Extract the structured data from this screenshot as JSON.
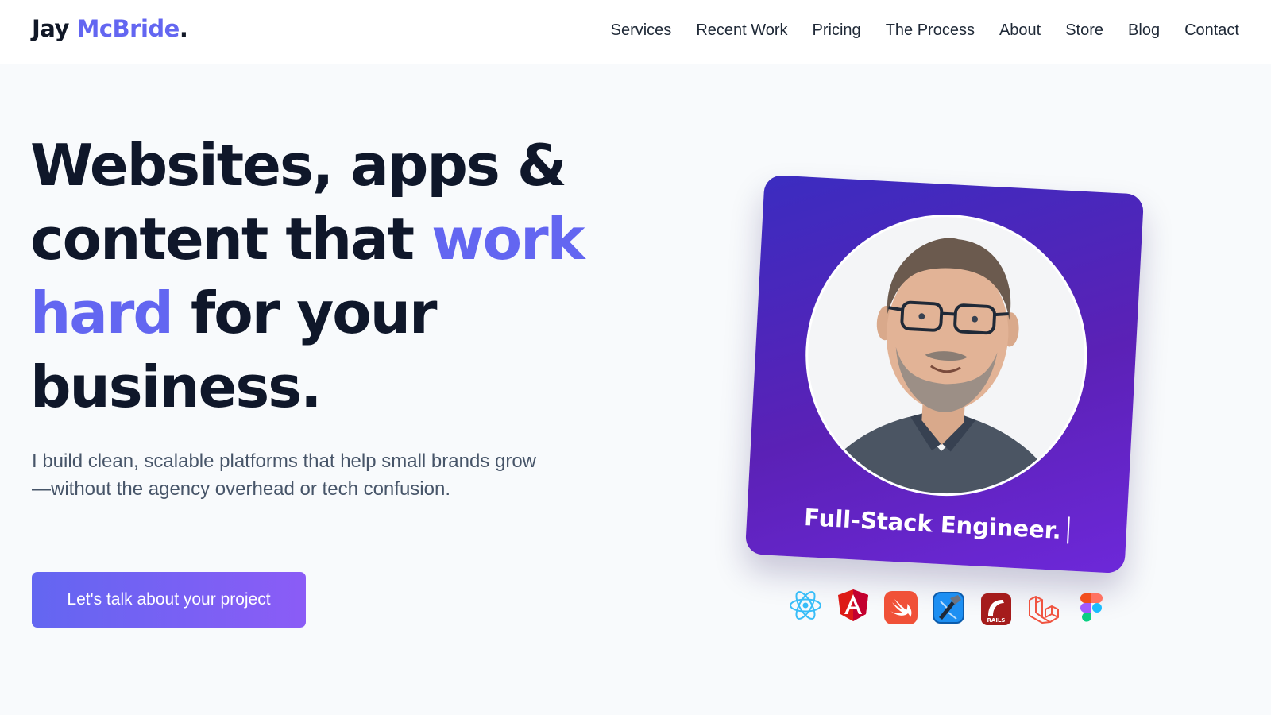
{
  "header": {
    "logo": {
      "first": "Jay",
      "last": "McBride",
      "dot": "."
    },
    "nav": [
      {
        "label": "Services"
      },
      {
        "label": "Recent Work"
      },
      {
        "label": "Pricing"
      },
      {
        "label": "The Process"
      },
      {
        "label": "About"
      },
      {
        "label": "Store"
      },
      {
        "label": "Blog"
      },
      {
        "label": "Contact"
      }
    ]
  },
  "hero": {
    "headline": {
      "line1": "Websites, apps &",
      "line2_plain": "content that ",
      "line2_highlight": "work",
      "line3_highlight": "hard",
      "line3_plain": " for your",
      "line4": "business."
    },
    "subtext": "I build clean, scalable platforms that help small brands grow—without the agency overhead or tech confusion.",
    "cta_label": "Let's talk about your project"
  },
  "profile_card": {
    "caption": "Full-Stack Engineer.",
    "photo": "portrait-photo",
    "tech_icons": [
      "react-icon",
      "angular-icon",
      "swift-icon",
      "xcode-icon",
      "rails-icon",
      "laravel-icon",
      "figma-icon"
    ]
  },
  "colors": {
    "accent": "#6366f1",
    "card_gradient_start": "#3b2cc0",
    "card_gradient_end": "#6d28d9",
    "text_dark": "#0f172a",
    "text_muted": "#475569"
  }
}
